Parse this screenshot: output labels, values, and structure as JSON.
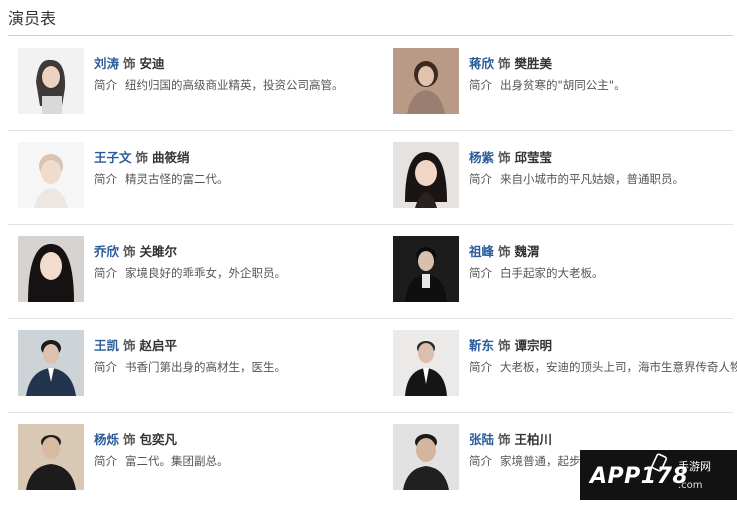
{
  "heading": "演员表",
  "connector": "饰",
  "desc_label": "简介",
  "cast": [
    {
      "actor": "刘涛",
      "role": "安迪",
      "desc": "纽约归国的高级商业精英，投资公司高管。"
    },
    {
      "actor": "蒋欣",
      "role": "樊胜美",
      "desc": "出身贫寒的\"胡同公主\"。"
    },
    {
      "actor": "王子文",
      "role": "曲筱绡",
      "desc": "精灵古怪的富二代。"
    },
    {
      "actor": "杨紫",
      "role": "邱莹莹",
      "desc": "来自小城市的平凡姑娘，普通职员。"
    },
    {
      "actor": "乔欣",
      "role": "关雎尔",
      "desc": "家境良好的乖乖女，外企职员。"
    },
    {
      "actor": "祖峰",
      "role": "魏渭",
      "desc": "白手起家的大老板。"
    },
    {
      "actor": "王凯",
      "role": "赵启平",
      "desc": "书香门第出身的高材生，医生。"
    },
    {
      "actor": "靳东",
      "role": "谭宗明",
      "desc": "大老板，安迪的顶头上司，海市生意界传奇人物"
    },
    {
      "actor": "杨烁",
      "role": "包奕凡",
      "desc": "富二代。集团副总。"
    },
    {
      "actor": "张陆",
      "role": "王柏川",
      "desc": "家境普通，起步"
    }
  ],
  "watermark": {
    "text": "APP178",
    "sub": "手游网",
    "domain": ".com"
  },
  "colors": {
    "actor_name": "#2a5c9a",
    "divider": "#e3e3e3"
  }
}
